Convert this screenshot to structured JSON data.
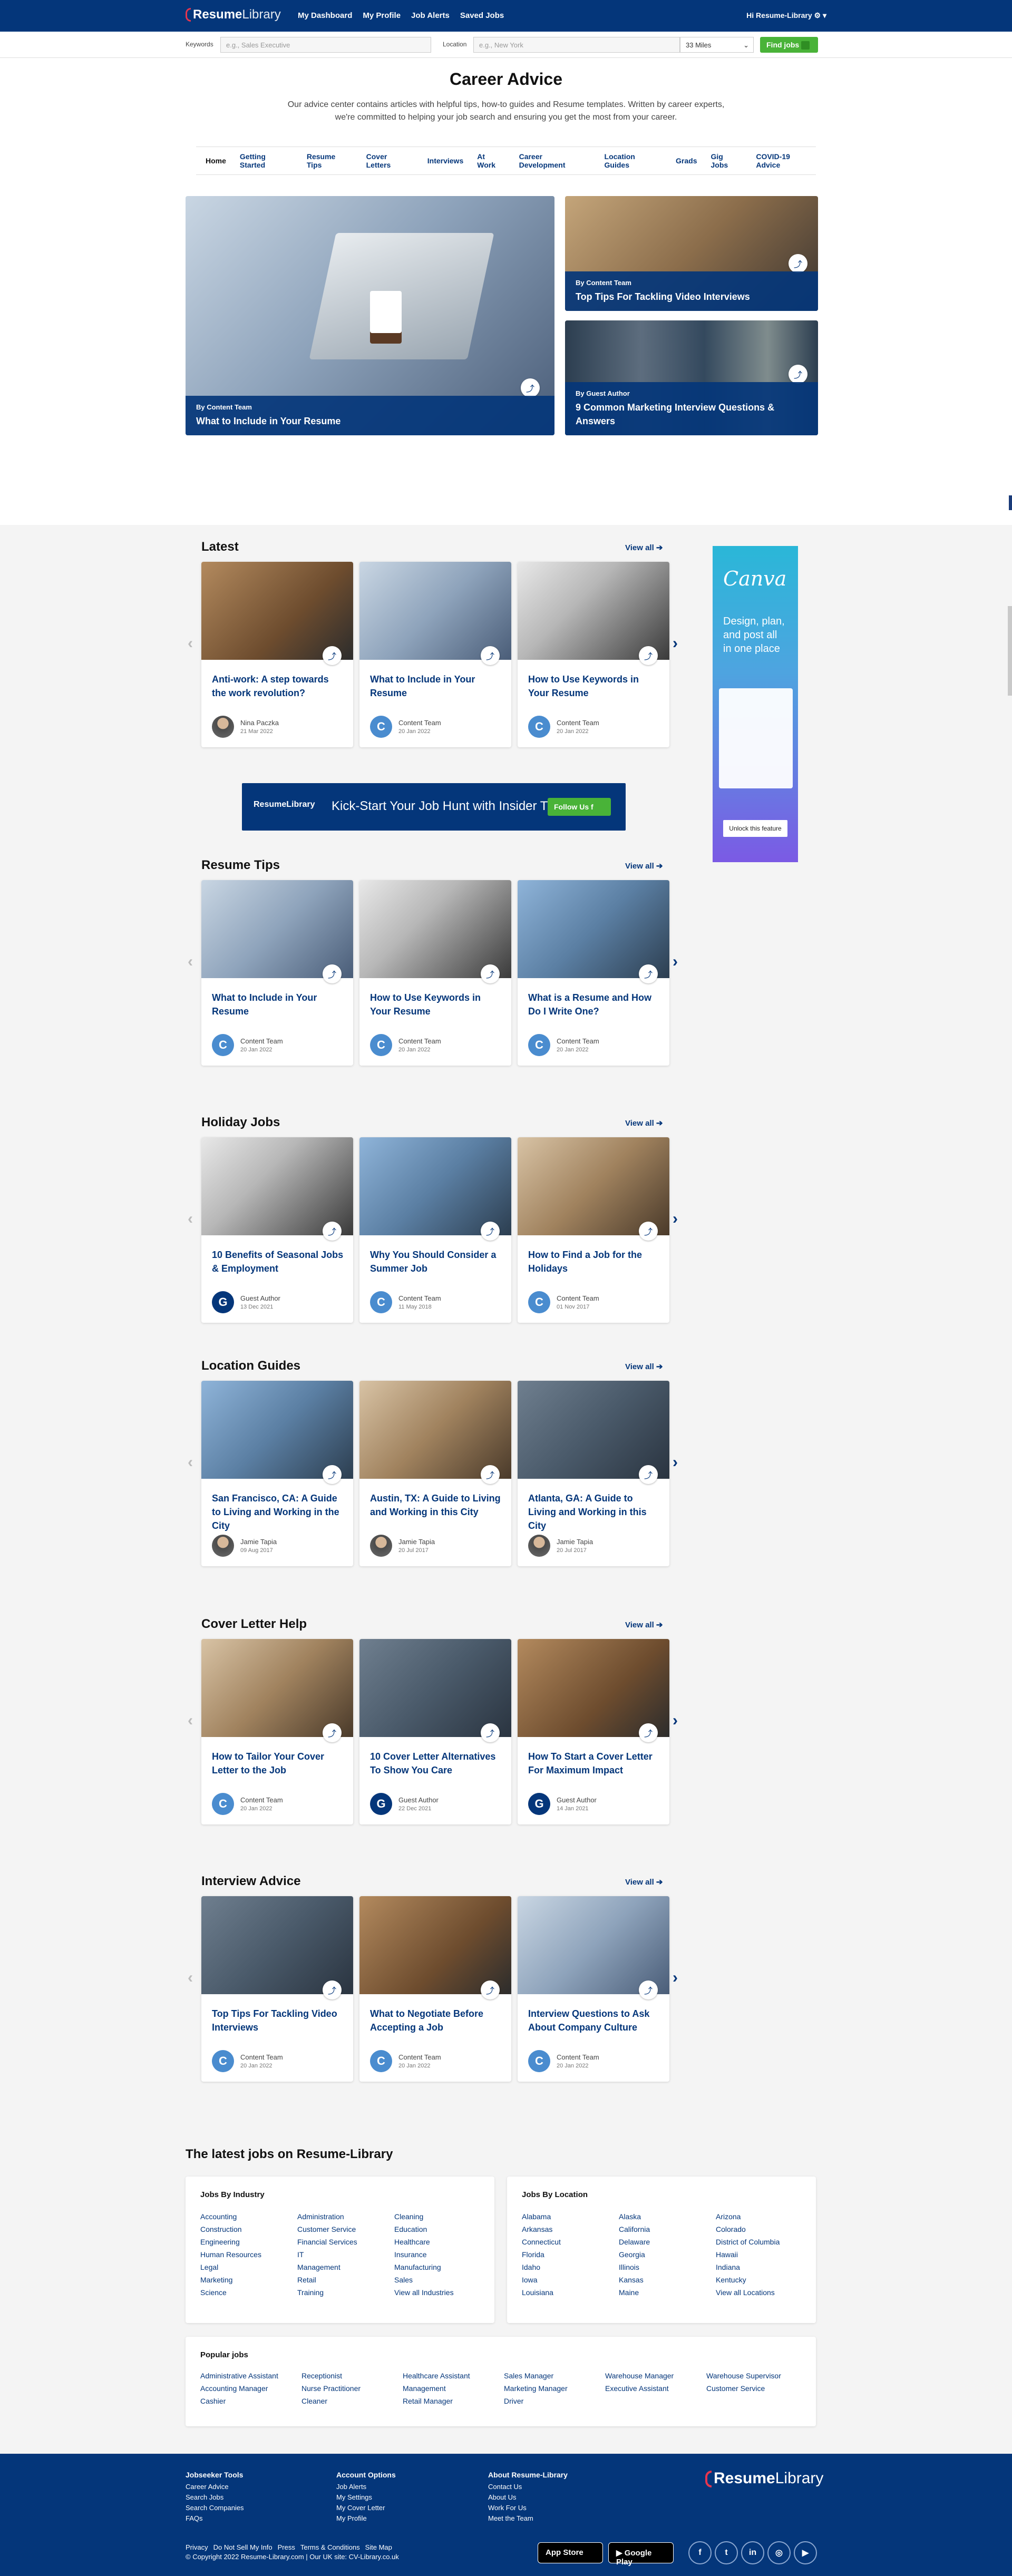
{
  "header": {
    "logo_bold": "Resume",
    "logo_rest": "Library",
    "nav": [
      "My Dashboard",
      "My Profile",
      "Job Alerts",
      "Saved Jobs"
    ],
    "account": "Hi Resume-Library ⚙ ▾"
  },
  "search": {
    "keywords_label": "Keywords",
    "keywords_placeholder": "e.g., Sales Executive",
    "location_label": "Location",
    "location_placeholder": "e.g., New York",
    "radius": "33 Miles",
    "button": "Find jobs"
  },
  "intro": {
    "title": "Career Advice",
    "text": "Our advice center contains articles with helpful tips, how-to guides and Resume templates. Written by career experts, we're committed to helping your job search and ensuring you get the most from your career."
  },
  "categories": [
    "Home",
    "Getting Started",
    "Resume Tips",
    "Cover Letters",
    "Interviews",
    "At Work",
    "Career Development",
    "Location Guides",
    "Grads",
    "Gig Jobs",
    "COVID-19 Advice"
  ],
  "featured": [
    {
      "by": "By Content Team",
      "title": "What to Include in Your Resume"
    },
    {
      "by": "By Content Team",
      "title": "Top Tips For Tackling Video Interviews"
    },
    {
      "by": "By Guest Author",
      "title": "9 Common Marketing Interview Questions & Answers"
    }
  ],
  "view_all": "View all ➔",
  "sections": [
    {
      "title": "Latest",
      "cards": [
        {
          "title": "Anti-work: A step towards the work revolution?",
          "author": "Nina Paczka",
          "date": "21 Mar 2022",
          "avatar": "photo"
        },
        {
          "title": "What to Include in Your Resume",
          "author": "Content Team",
          "date": "20 Jan 2022",
          "avatar": "C"
        },
        {
          "title": "How to Use Keywords in Your Resume",
          "author": "Content Team",
          "date": "20 Jan 2022",
          "avatar": "C"
        }
      ]
    },
    {
      "title": "Resume Tips",
      "cards": [
        {
          "title": "What to Include in Your Resume",
          "author": "Content Team",
          "date": "20 Jan 2022",
          "avatar": "C"
        },
        {
          "title": "How to Use Keywords in Your Resume",
          "author": "Content Team",
          "date": "20 Jan 2022",
          "avatar": "C"
        },
        {
          "title": "What is a Resume and How Do I Write One?",
          "author": "Content Team",
          "date": "20 Jan 2022",
          "avatar": "C"
        }
      ]
    },
    {
      "title": "Holiday Jobs",
      "cards": [
        {
          "title": "10 Benefits of Seasonal Jobs & Employment",
          "author": "Guest Author",
          "date": "13 Dec 2021",
          "avatar": "G"
        },
        {
          "title": "Why You Should Consider a Summer Job",
          "author": "Content Team",
          "date": "11 May 2018",
          "avatar": "C"
        },
        {
          "title": "How to Find a Job for the Holidays",
          "author": "Content Team",
          "date": "01 Nov 2017",
          "avatar": "C"
        }
      ]
    },
    {
      "title": "Location Guides",
      "cards": [
        {
          "title": "San Francisco, CA: A Guide to Living and Working in the City",
          "author": "Jamie Tapia",
          "date": "09 Aug 2017",
          "avatar": "photo"
        },
        {
          "title": "Austin, TX: A Guide to Living and Working in this City",
          "author": "Jamie Tapia",
          "date": "20 Jul 2017",
          "avatar": "photo"
        },
        {
          "title": "Atlanta, GA: A Guide to Living and Working in this City",
          "author": "Jamie Tapia",
          "date": "20 Jul 2017",
          "avatar": "photo"
        }
      ]
    },
    {
      "title": "Cover Letter Help",
      "cards": [
        {
          "title": "How to Tailor Your Cover Letter to the Job",
          "author": "Content Team",
          "date": "20 Jan 2022",
          "avatar": "C"
        },
        {
          "title": "10 Cover Letter Alternatives To Show You Care",
          "author": "Guest Author",
          "date": "22 Dec 2021",
          "avatar": "G"
        },
        {
          "title": "How To Start a Cover Letter For Maximum Impact",
          "author": "Guest Author",
          "date": "14 Jan 2021",
          "avatar": "G"
        }
      ]
    },
    {
      "title": "Interview Advice",
      "cards": [
        {
          "title": "Top Tips For Tackling Video Interviews",
          "author": "Content Team",
          "date": "20 Jan 2022",
          "avatar": "C"
        },
        {
          "title": "What to Negotiate Before Accepting a Job",
          "author": "Content Team",
          "date": "20 Jan 2022",
          "avatar": "C"
        },
        {
          "title": "Interview Questions to Ask About Company Culture",
          "author": "Content Team",
          "date": "20 Jan 2022",
          "avatar": "C"
        }
      ]
    }
  ],
  "banner": {
    "logo": "ResumeLibrary",
    "text": "Kick-Start Your Job Hunt with Insider Tips",
    "button": "Follow Us f"
  },
  "side_ad": {
    "brand": "Canva",
    "text": "Design, plan, and post all in one place",
    "button": "Unlock this feature"
  },
  "jobs": {
    "title": "The latest jobs on Resume-Library",
    "industry_title": "Jobs By Industry",
    "industry": [
      [
        "Accounting",
        "Construction",
        "Engineering",
        "Human Resources",
        "Legal",
        "Marketing",
        "Science"
      ],
      [
        "Administration",
        "Customer Service",
        "Financial Services",
        "IT",
        "Management",
        "Retail",
        "Training"
      ],
      [
        "Cleaning",
        "Education",
        "Healthcare",
        "Insurance",
        "Manufacturing",
        "Sales",
        "View all Industries"
      ]
    ],
    "location_title": "Jobs By Location",
    "location": [
      [
        "Alabama",
        "Arkansas",
        "Connecticut",
        "Florida",
        "Idaho",
        "Iowa",
        "Louisiana"
      ],
      [
        "Alaska",
        "California",
        "Delaware",
        "Georgia",
        "Illinois",
        "Kansas",
        "Maine"
      ],
      [
        "Arizona",
        "Colorado",
        "District of Columbia",
        "Hawaii",
        "Indiana",
        "Kentucky",
        "View all Locations"
      ]
    ],
    "popular_title": "Popular jobs",
    "popular": [
      [
        "Administrative Assistant",
        "Accounting Manager",
        "Cashier"
      ],
      [
        "Receptionist",
        "Nurse Practitioner",
        "Cleaner"
      ],
      [
        "Healthcare Assistant",
        "Management",
        "Retail Manager"
      ],
      [
        "Sales Manager",
        "Marketing Manager",
        "Driver"
      ],
      [
        "Warehouse Manager",
        "Executive Assistant"
      ],
      [
        "Warehouse Supervisor",
        "Customer Service"
      ]
    ]
  },
  "footer": {
    "cols": [
      {
        "title": "Jobseeker Tools",
        "links": [
          "Career Advice",
          "Search Jobs",
          "Search Companies",
          "FAQs"
        ]
      },
      {
        "title": "Account Options",
        "links": [
          "Job Alerts",
          "My Settings",
          "My Cover Letter",
          "My Profile"
        ]
      },
      {
        "title": "About Resume-Library",
        "links": [
          "Contact Us",
          "About Us",
          "Work For Us",
          "Meet the Team"
        ]
      }
    ],
    "bottom_links": [
      "Privacy",
      "Do Not Sell My Info",
      "Press",
      "Terms & Conditions",
      "Site Map"
    ],
    "copyright": "© Copyright 2022 Resume-Library.com | Our UK site: CV-Library.co.uk",
    "app_store": "App Store",
    "google_play": "Google Play",
    "social": [
      "f",
      "t",
      "in",
      "◎",
      "▶"
    ]
  },
  "colors": {
    "brand": "#04367a",
    "green": "#49b338",
    "red": "#e7354e"
  }
}
